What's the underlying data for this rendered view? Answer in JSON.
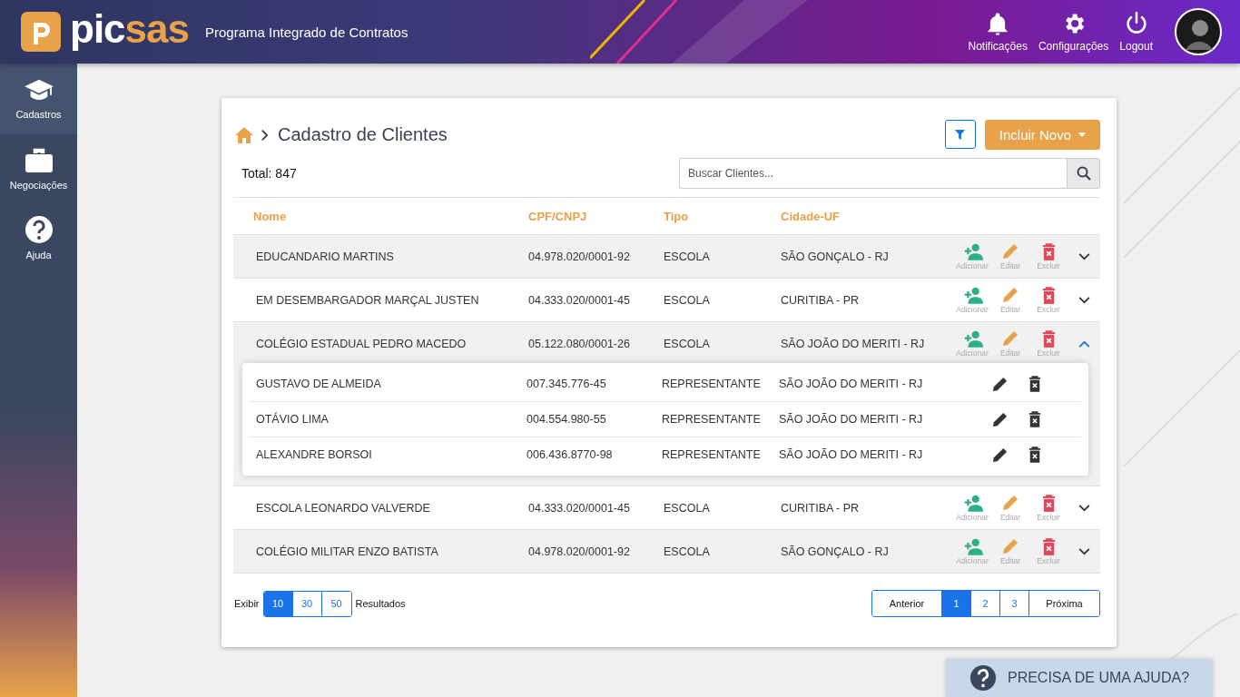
{
  "header": {
    "logo_main": "pic",
    "logo_accent": "sas",
    "app_title": "Programa Integrado de Contratos",
    "actions": [
      {
        "kind": "bell",
        "label": "Notificações"
      },
      {
        "kind": "gear",
        "label": "Configurações"
      },
      {
        "kind": "power",
        "label": "Logout"
      }
    ]
  },
  "sidebar": {
    "items": [
      {
        "kind": "cap",
        "label": "Cadastros",
        "selected": true
      },
      {
        "kind": "briefcase",
        "label": "Negociações",
        "selected": false
      },
      {
        "kind": "help",
        "label": "Ajuda",
        "selected": false
      }
    ]
  },
  "page": {
    "title": "Cadastro de Clientes",
    "new_button": "Incluir Novo",
    "total": "Total: 847",
    "search": {
      "placeholder": "Buscar Clientes..."
    }
  },
  "table": {
    "columns": [
      "Nome",
      "CPF/CNPJ",
      "Tipo",
      "Cidade-UF"
    ],
    "rows": [
      {
        "name": "EDUCANDARIO MARTINS",
        "doc": "04.978.020/0001-92",
        "type": "ESCOLA",
        "city": "SÃO GONÇALO - RJ",
        "expanded": false,
        "actions": [
          {
            "kind": "add",
            "label": "Adicionar"
          },
          {
            "kind": "edit",
            "label": "Editar"
          },
          {
            "kind": "delete",
            "label": "Excluir"
          }
        ]
      },
      {
        "name": "EM DESEMBARGADOR MARÇAL JUSTEN",
        "doc": "04.333.020/0001-45",
        "type": "ESCOLA",
        "city": "CURITIBA - PR",
        "expanded": false,
        "actions": [
          {
            "kind": "add",
            "label": "Adicionar"
          },
          {
            "kind": "edit",
            "label": "Editar"
          },
          {
            "kind": "delete",
            "label": "Excluir"
          }
        ]
      },
      {
        "name": "COLÉGIO ESTADUAL PEDRO MACEDO",
        "doc": "05.122.080/0001-26",
        "type": "ESCOLA",
        "city": "SÃO JOÃO DO MERITI - RJ",
        "expanded": true,
        "actions": [
          {
            "kind": "add",
            "label": "Adicionar"
          },
          {
            "kind": "edit",
            "label": "Editar"
          },
          {
            "kind": "delete",
            "label": "Excluir"
          }
        ],
        "children": [
          {
            "name": "GUSTAVO DE ALMEIDA",
            "doc": "007.345.776-45",
            "type": "REPRESENTANTE",
            "city": "SÃO JOÃO DO MERITI - RJ"
          },
          {
            "name": "OTÁVIO LIMA",
            "doc": "004.554.980-55",
            "type": "REPRESENTANTE",
            "city": "SÃO JOÃO DO MERITI - RJ"
          },
          {
            "name": "ALEXANDRE BORSOI",
            "doc": "006.436.8770-98",
            "type": "REPRESENTANTE",
            "city": "SÃO JOÃO DO MERITI - RJ"
          }
        ]
      },
      {
        "name": "ESCOLA LEONARDO VALVERDE",
        "doc": "04.333.020/0001-45",
        "type": "ESCOLA",
        "city": "CURITIBA - PR",
        "expanded": false,
        "actions": [
          {
            "kind": "add",
            "label": "Adicionar"
          },
          {
            "kind": "edit",
            "label": "Editar"
          },
          {
            "kind": "delete",
            "label": "Excluir"
          }
        ]
      },
      {
        "name": "COLÉGIO MILITAR ENZO BATISTA",
        "doc": "04.978.020/0001-92",
        "type": "ESCOLA",
        "city": "SÃO GONÇALO - RJ",
        "expanded": false,
        "actions": [
          {
            "kind": "add",
            "label": "Adicionar"
          },
          {
            "kind": "edit",
            "label": "Editar"
          },
          {
            "kind": "delete",
            "label": "Excluir"
          }
        ]
      }
    ]
  },
  "footer": {
    "show_label": "Exibir",
    "results_label": "Resultados",
    "page_sizes": [
      {
        "label": "10",
        "selected": true
      },
      {
        "label": "30",
        "selected": false
      },
      {
        "label": "50",
        "selected": false
      }
    ],
    "prev": "Anterior",
    "next": "Próxima",
    "pages": [
      {
        "label": "1",
        "selected": true
      },
      {
        "label": "2",
        "selected": false
      },
      {
        "label": "3",
        "selected": false
      }
    ]
  },
  "help_button": "PRECISA DE UMA AJUDA?"
}
